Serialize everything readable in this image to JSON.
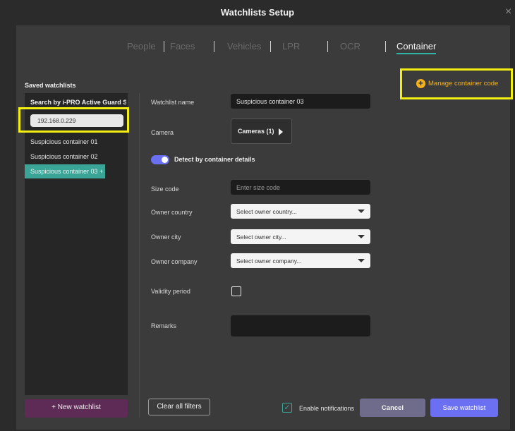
{
  "window": {
    "title": "Watchlists Setup",
    "close_glyph": "×"
  },
  "tabs": [
    {
      "label": "People",
      "active": false
    },
    {
      "label": "Faces",
      "active": false
    },
    {
      "label": "Vehicles",
      "active": false
    },
    {
      "label": "LPR",
      "active": false
    },
    {
      "label": "OCR",
      "active": false
    },
    {
      "label": "Container",
      "active": true
    }
  ],
  "sidebar": {
    "title": "Saved watchlists",
    "header": "Search by i-PRO Active Guard Se...",
    "ip_address": "192.168.0.229",
    "items": [
      {
        "label": "Suspicious container 01"
      },
      {
        "label": "Suspicious container 02"
      },
      {
        "label": "Suspicious container 03 +",
        "selected": true
      }
    ],
    "new_watchlist_label": "+ New watchlist"
  },
  "manage": {
    "label": "Manage container code",
    "icon": "plus-circle-icon",
    "icon_glyph": "+"
  },
  "form": {
    "watchlist_name": {
      "label": "Watchlist name",
      "value": "Suspicious container 03"
    },
    "camera": {
      "label": "Camera",
      "button_label": "Cameras (1)"
    },
    "detect_toggle": {
      "label": "Detect by container details",
      "on": true
    },
    "size_code": {
      "label": "Size code",
      "placeholder": "Enter size code"
    },
    "owner_country": {
      "label": "Owner country",
      "value": "Select owner country..."
    },
    "owner_city": {
      "label": "Owner city",
      "value": "Select owner city..."
    },
    "owner_company": {
      "label": "Owner company",
      "value": "Select owner company..."
    },
    "validity_period": {
      "label": "Validity period",
      "checked": false
    },
    "remarks": {
      "label": "Remarks",
      "value": ""
    }
  },
  "footer": {
    "clear_label": "Clear all filters",
    "enable_notifications": {
      "label": "Enable notifications",
      "checked": true
    },
    "cancel_label": "Cancel",
    "save_label": "Save watchlist"
  },
  "colors": {
    "accent_teal": "#3aa597",
    "accent_purple": "#6b6ff2",
    "highlight_yellow": "#f3f011",
    "manage_orange": "#f5b21b"
  }
}
